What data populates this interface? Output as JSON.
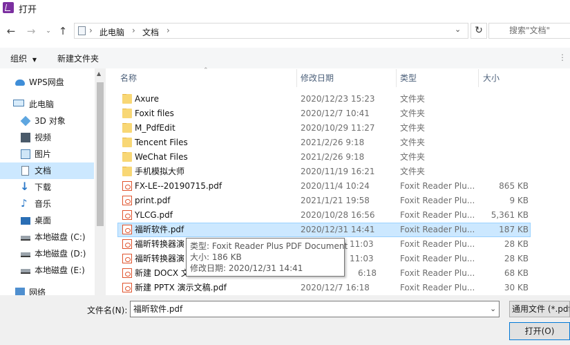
{
  "window": {
    "title": "打开"
  },
  "address": {
    "path": [
      "此电脑",
      "文档"
    ]
  },
  "search": {
    "placeholder": "搜索\"文档\""
  },
  "toolbar": {
    "organize": "组织",
    "new_folder": "新建文件夹"
  },
  "nav": {
    "items": [
      {
        "label": "WPS网盘",
        "icon": "cloud-icon"
      },
      {
        "label": "此电脑",
        "icon": "computer-icon"
      },
      {
        "label": "3D 对象",
        "icon": "3d-objects-icon"
      },
      {
        "label": "视频",
        "icon": "video-icon"
      },
      {
        "label": "图片",
        "icon": "pictures-icon"
      },
      {
        "label": "文档",
        "icon": "documents-icon"
      },
      {
        "label": "下载",
        "icon": "download-icon"
      },
      {
        "label": "音乐",
        "icon": "music-icon"
      },
      {
        "label": "桌面",
        "icon": "desktop-icon"
      },
      {
        "label": "本地磁盘 (C:)",
        "icon": "drive-icon"
      },
      {
        "label": "本地磁盘 (D:)",
        "icon": "drive-icon"
      },
      {
        "label": "本地磁盘 (E:)",
        "icon": "drive-icon"
      },
      {
        "label": "网络",
        "icon": "network-icon"
      }
    ]
  },
  "columns": {
    "name": "名称",
    "date": "修改日期",
    "type": "类型",
    "size": "大小"
  },
  "files": [
    {
      "name": "Axure",
      "date": "2020/12/23 15:23",
      "type": "文件夹",
      "size": "",
      "kind": "folder"
    },
    {
      "name": "Foxit files",
      "date": "2020/12/7 10:41",
      "type": "文件夹",
      "size": "",
      "kind": "folder"
    },
    {
      "name": "M_PdfEdit",
      "date": "2020/10/29 11:27",
      "type": "文件夹",
      "size": "",
      "kind": "folder"
    },
    {
      "name": "Tencent Files",
      "date": "2021/2/26 9:18",
      "type": "文件夹",
      "size": "",
      "kind": "folder"
    },
    {
      "name": "WeChat Files",
      "date": "2021/2/26 9:18",
      "type": "文件夹",
      "size": "",
      "kind": "folder"
    },
    {
      "name": "手机模拟大师",
      "date": "2020/11/19 16:21",
      "type": "文件夹",
      "size": "",
      "kind": "folder"
    },
    {
      "name": "FX-LE--20190715.pdf",
      "date": "2020/11/4 10:24",
      "type": "Foxit Reader Plu...",
      "size": "865 KB",
      "kind": "pdf"
    },
    {
      "name": "print.pdf",
      "date": "2021/1/21 19:58",
      "type": "Foxit Reader Plu...",
      "size": "9 KB",
      "kind": "pdf"
    },
    {
      "name": "YLCG.pdf",
      "date": "2020/10/28 16:56",
      "type": "Foxit Reader Plu...",
      "size": "5,361 KB",
      "kind": "pdf"
    },
    {
      "name": "福昕软件.pdf",
      "date": "2020/12/31 14:41",
      "type": "Foxit Reader Plu...",
      "size": "187 KB",
      "kind": "pdf",
      "selected": true
    },
    {
      "name": "福昕转换器演",
      "date": "11:03",
      "type": "Foxit Reader Plu...",
      "size": "28 KB",
      "kind": "pdf"
    },
    {
      "name": "福昕转换器演",
      "date": "11:03",
      "type": "Foxit Reader Plu...",
      "size": "28 KB",
      "kind": "pdf"
    },
    {
      "name": "新建 DOCX 文",
      "date": "6:18",
      "type": "Foxit Reader Plu...",
      "size": "68 KB",
      "kind": "pdf"
    },
    {
      "name": "新建 PPTX 演示文稿.pdf",
      "date": "2020/12/7 16:18",
      "type": "Foxit Reader Plu...",
      "size": "30 KB",
      "kind": "pdf"
    }
  ],
  "tooltip": {
    "type": "类型: Foxit Reader Plus PDF Document",
    "size": "大小: 186 KB",
    "date": "修改日期: 2020/12/31 14:41"
  },
  "bottom": {
    "filename_label": "文件名(N):",
    "filename_value": "福昕软件.pdf",
    "filetype_value": "通用文件 (*.pdf",
    "open_label": "打开(O)"
  },
  "colors": {
    "accent": "#0078d7",
    "selection": "#cce8ff",
    "pdf": "#e0522b",
    "folder": "#f8d775"
  }
}
